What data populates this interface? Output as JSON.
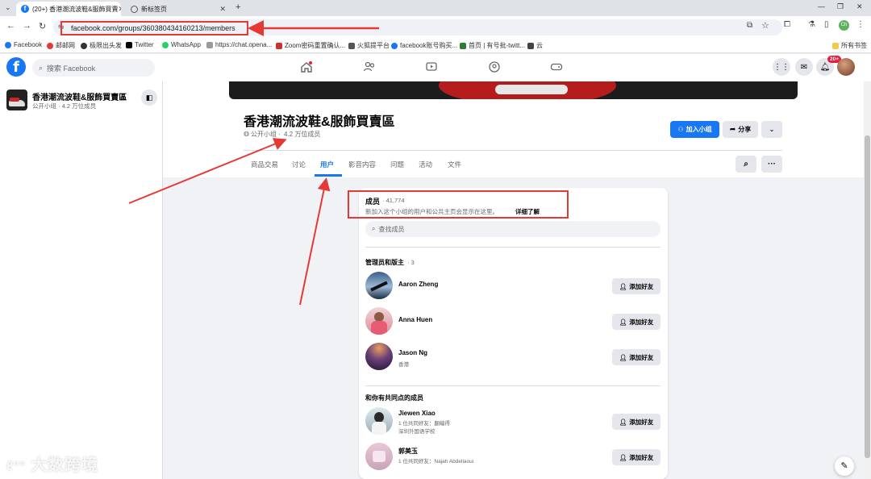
{
  "browser": {
    "tabs": [
      {
        "title": "(20+) 香港潮流波鞋&服飾買賣",
        "active": true
      },
      {
        "title": "新标签页",
        "active": false
      }
    ],
    "new_tab": "+",
    "url": "facebook.com/groups/360380434160213/members",
    "bookmarks": [
      "Facebook",
      "邮邮网",
      "极限出头发",
      "Twitter",
      "WhatsApp",
      "https://chat.opena...",
      "Zoom密码重置确认...",
      "火狐提平台",
      "facebook账号购买...",
      "首页 | 有号批-twitt...",
      "云"
    ],
    "all_bookmarks": "所有书签",
    "profile_initial": "Ch"
  },
  "facebook": {
    "search_placeholder": "搜索 Facebook",
    "notification_badge": "20+"
  },
  "sidebar": {
    "group_name": "香港潮流波鞋&服飾買賣區",
    "group_meta": "公开小组 · 4.2 万位成员"
  },
  "group": {
    "title": "香港潮流波鞋&服飾買賣區",
    "privacy": "公开小组 · ",
    "members_count": "4.2 万位成员",
    "join_label": "加入小组",
    "share_label": "分享",
    "tabs": [
      "商品交易",
      "讨论",
      "用户",
      "影音内容",
      "问题",
      "活动",
      "文件"
    ],
    "active_tab": "用户"
  },
  "members_card": {
    "title": "成员",
    "count": " · 41,774",
    "desc": "新加入这个小组的用户和公共主页会显示在这里。",
    "learn_more": "详细了解",
    "search_placeholder": "查找成员",
    "admins_title": "管理员和版主",
    "admins_count": " · 3",
    "add_friend": "添加好友",
    "admins": [
      {
        "name": "Aaron Zheng",
        "sub": ""
      },
      {
        "name": "Anna Huen",
        "sub": ""
      },
      {
        "name": "Jason Ng",
        "sub": "香港"
      }
    ],
    "common_title": "和你有共同点的成员",
    "common": [
      {
        "name": "Jiewen Xiao",
        "sub1": "1 位共同好友：翻编得",
        "sub2": "深圳外国语学校"
      },
      {
        "name": "郭美玉",
        "sub1": "1 位共同好友：Najah Abdellaoui",
        "sub2": ""
      }
    ]
  },
  "watermark": "大数跨境",
  "colors": {
    "fb_blue": "#1877f2",
    "annotation_red": "#e53935",
    "page_bg": "#f0f2f5"
  }
}
